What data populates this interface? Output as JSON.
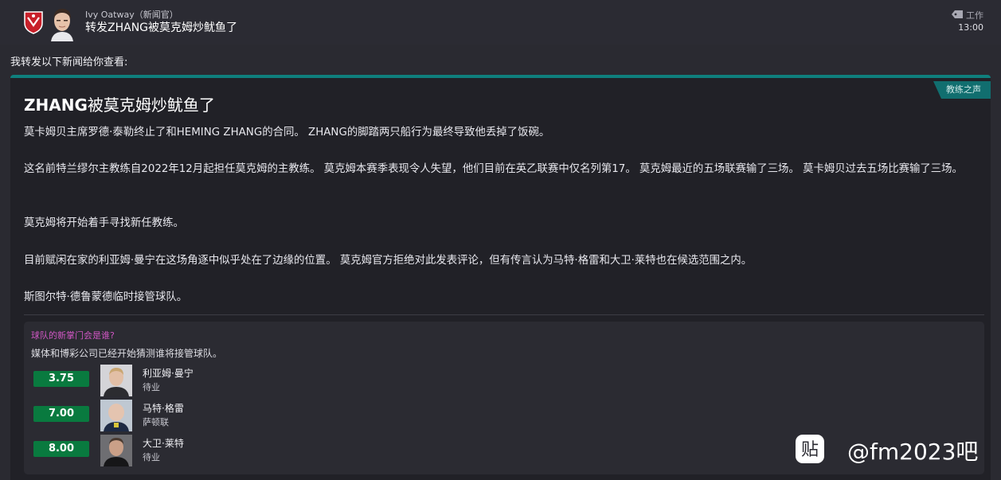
{
  "header": {
    "sender": "Ivy Oatway（新闻官）",
    "subject": "转发ZHANG被莫克姆炒鱿鱼了",
    "tag": "工作",
    "time": "13:00"
  },
  "intro": "我转发以下新闻给你查看:",
  "article": {
    "category": "教练之声",
    "headline_bold": "ZHANG",
    "headline_rest": "被莫克姆炒鱿鱼了",
    "paragraphs": [
      "莫卡姆贝主席罗德·泰勒终止了和HEMING ZHANG的合同。 ZHANG的脚踏两只船行为最终导致他丢掉了饭碗。",
      "这名前特兰缪尔主教练自2022年12月起担任莫克姆的主教练。 莫克姆本赛季表现令人失望，他们目前在英乙联赛中仅名列第17。 莫克姆最近的五场联赛输了三场。 莫卡姆贝过去五场比赛输了三场。",
      "莫克姆将开始着手寻找新任教练。",
      "目前赋闲在家的利亚姆·曼宁在这场角逐中似乎处在了边缘的位置。 莫克姆官方拒绝对此发表评论，但有传言认为马特·格雷和大卫·莱特也在候选范围之内。",
      "斯图尔特·德鲁蒙德临时接管球队。"
    ]
  },
  "betting": {
    "title": "球队的新掌门会是谁?",
    "description": "媒体和博彩公司已经开始猜测谁将接管球队。",
    "candidates": [
      {
        "odds": "3.75",
        "name": "利亚姆·曼宁",
        "club": "待业"
      },
      {
        "odds": "7.00",
        "name": "马特·格雷",
        "club": "萨顿联"
      },
      {
        "odds": "8.00",
        "name": "大卫·莱特",
        "club": "待业"
      }
    ]
  },
  "watermark": {
    "logo_char": "贴",
    "text": "@fm2023吧"
  },
  "colors": {
    "accent_teal": "#0f7f7d",
    "odds_green": "#097a3f",
    "question_pink": "#d057c4"
  }
}
